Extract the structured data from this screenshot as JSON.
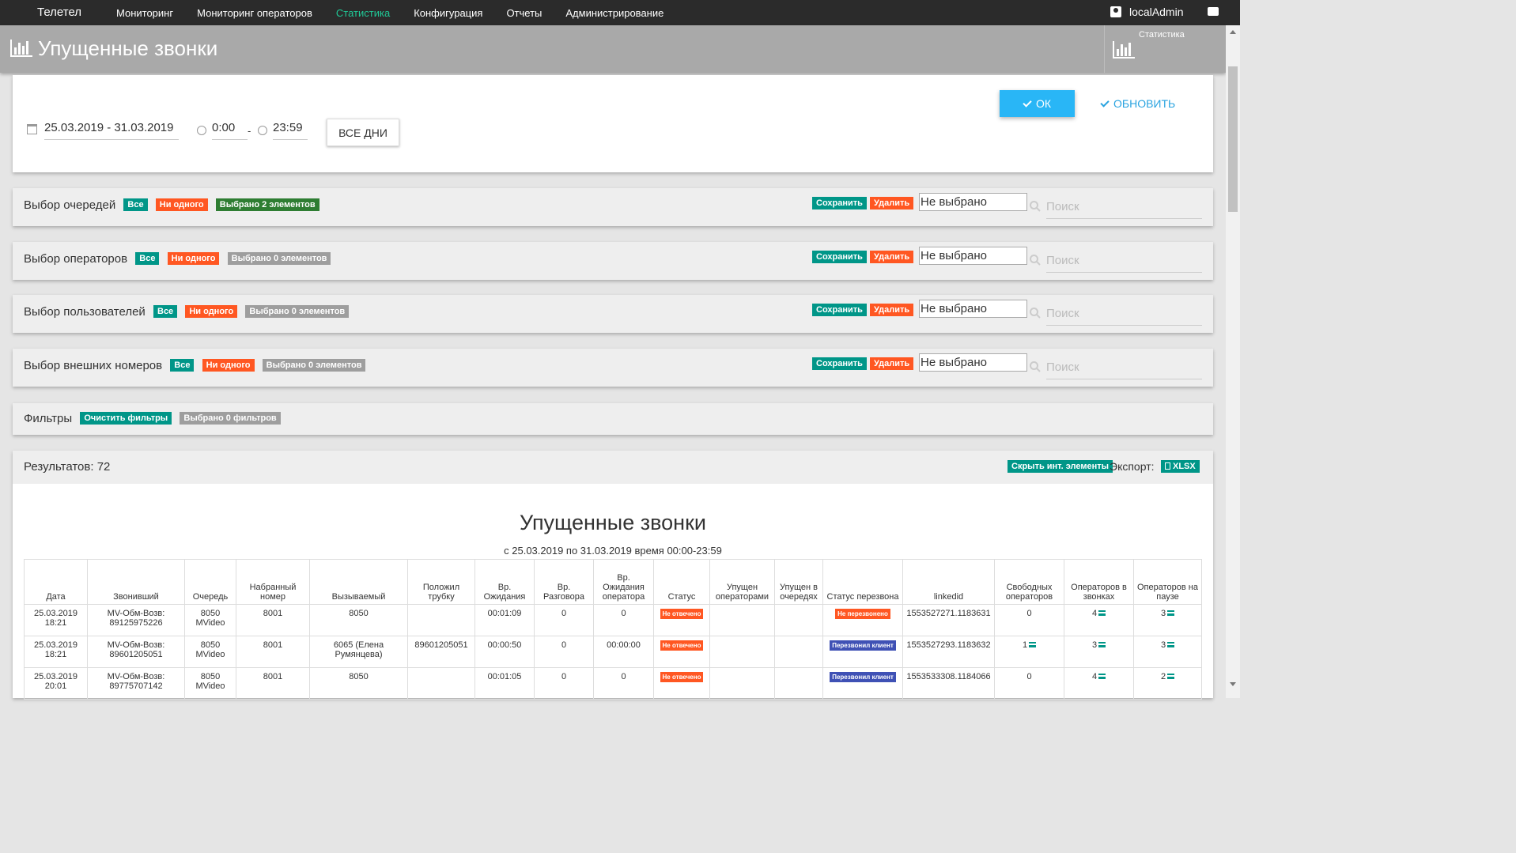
{
  "nav": {
    "brand": "Телетел",
    "items": [
      "Мониторинг",
      "Мониторинг операторов",
      "Статистика",
      "Конфигурация",
      "Отчеты",
      "Администрирование"
    ],
    "active": "Статистика",
    "user": "localAdmin"
  },
  "header": {
    "title": "Упущенные звонки",
    "side_label": "Статистика"
  },
  "filters": {
    "date_range": "25.03.2019 - 31.03.2019",
    "time_from": "0:00",
    "time_sep": "-",
    "time_to": "23:59",
    "all_days": "ВСЕ ДНИ",
    "ok": "ОК",
    "refresh": "ОБНОВИТЬ"
  },
  "selectors": [
    {
      "title": "Выбор очередей",
      "all": "Все",
      "none": "Ни одного",
      "selected": "Выбрано 2 элементов",
      "save": "Сохранить",
      "delete": "Удалить",
      "value": "Не выбрано",
      "search": "Поиск"
    },
    {
      "title": "Выбор операторов",
      "all": "Все",
      "none": "Ни одного",
      "selected": "Выбрано 0 элементов",
      "save": "Сохранить",
      "delete": "Удалить",
      "value": "Не выбрано",
      "search": "Поиск"
    },
    {
      "title": "Выбор пользователей",
      "all": "Все",
      "none": "Ни одного",
      "selected": "Выбрано 0 элементов",
      "save": "Сохранить",
      "delete": "Удалить",
      "value": "Не выбрано",
      "search": "Поиск"
    },
    {
      "title": "Выбор внешних номеров",
      "all": "Все",
      "none": "Ни одного",
      "selected": "Выбрано 0 элементов",
      "save": "Сохранить",
      "delete": "Удалить",
      "value": "Не выбрано",
      "search": "Поиск"
    }
  ],
  "filter_panel": {
    "title": "Фильтры",
    "clear": "Очистить фильтры",
    "selected": "Выбрано 0 фильтров"
  },
  "results": {
    "count_label": "Результатов: 72",
    "hide_button": "Скрыть инт. элементы",
    "export_label": "Экспорт:",
    "xlsx": "XLSX",
    "title": "Упущенные звонки",
    "subtitle": "с 25.03.2019 по 31.03.2019 время 00:00-23:59",
    "columns": [
      "Дата",
      "Звонивший",
      "Очередь",
      "Набранный номер",
      "Вызываемый",
      "Положил трубку",
      "Вр. Ожидания",
      "Вр. Разговора",
      "Вр. Ожидания оператора",
      "Статус",
      "Упущен операторами",
      "Упущен в очередях",
      "Статус перезвона",
      "linkedid",
      "Свободных операторов",
      "Операторов в звонках",
      "Операторов на паузе"
    ],
    "rows": [
      {
        "date": "25.03.2019 18:21",
        "caller": "MV-Обм-Возв: 89125975226",
        "queue": "8050 MVideo",
        "dialed": "8001",
        "called": "8050",
        "hangup": "",
        "wait": "00:01:09",
        "talk": "0",
        "op_wait": "0",
        "status": "Не отвечено",
        "missed_ops": "",
        "missed_q": "",
        "callback": "Не перезвонено",
        "callback_color": "#ff5722",
        "linkedid": "1553527271.1183631",
        "free": "0",
        "free_list": false,
        "in_calls": "4",
        "in_calls_list": true,
        "paused": "3",
        "paused_list": true
      },
      {
        "date": "25.03.2019 18:21",
        "caller": "MV-Обм-Возв: 89601205051",
        "queue": "8050 MVideo",
        "dialed": "8001",
        "called": "6065 (Елена Румянцева)",
        "hangup": "89601205051",
        "wait": "00:00:50",
        "talk": "0",
        "op_wait": "00:00:00",
        "status": "Не отвечено",
        "missed_ops": "",
        "missed_q": "",
        "callback": "Перезвонил клиент",
        "callback_color": "#3f51b5",
        "linkedid": "1553527293.1183632",
        "free": "1",
        "free_list": true,
        "in_calls": "3",
        "in_calls_list": true,
        "paused": "3",
        "paused_list": true
      },
      {
        "date": "25.03.2019 20:01",
        "caller": "MV-Обм-Возв: 89775707142",
        "queue": "8050 MVideo",
        "dialed": "8001",
        "called": "8050",
        "hangup": "",
        "wait": "00:01:05",
        "talk": "0",
        "op_wait": "0",
        "status": "Не отвечено",
        "missed_ops": "",
        "missed_q": "",
        "callback": "Перезвонил клиент",
        "callback_color": "#3f51b5",
        "linkedid": "1553533308.1184066",
        "free": "0",
        "free_list": false,
        "in_calls": "4",
        "in_calls_list": true,
        "paused": "2",
        "paused_list": true
      }
    ]
  },
  "colors": {
    "nav_bg": "#2b2b2b",
    "active": "#20c997",
    "header_bg": "#a9a9a9",
    "ok_blue": "#29b6f6",
    "teal": "#009688",
    "orange": "#ff5722",
    "green": "#2e7d32",
    "grey": "#9e9e9e",
    "navy": "#3f51b5"
  }
}
